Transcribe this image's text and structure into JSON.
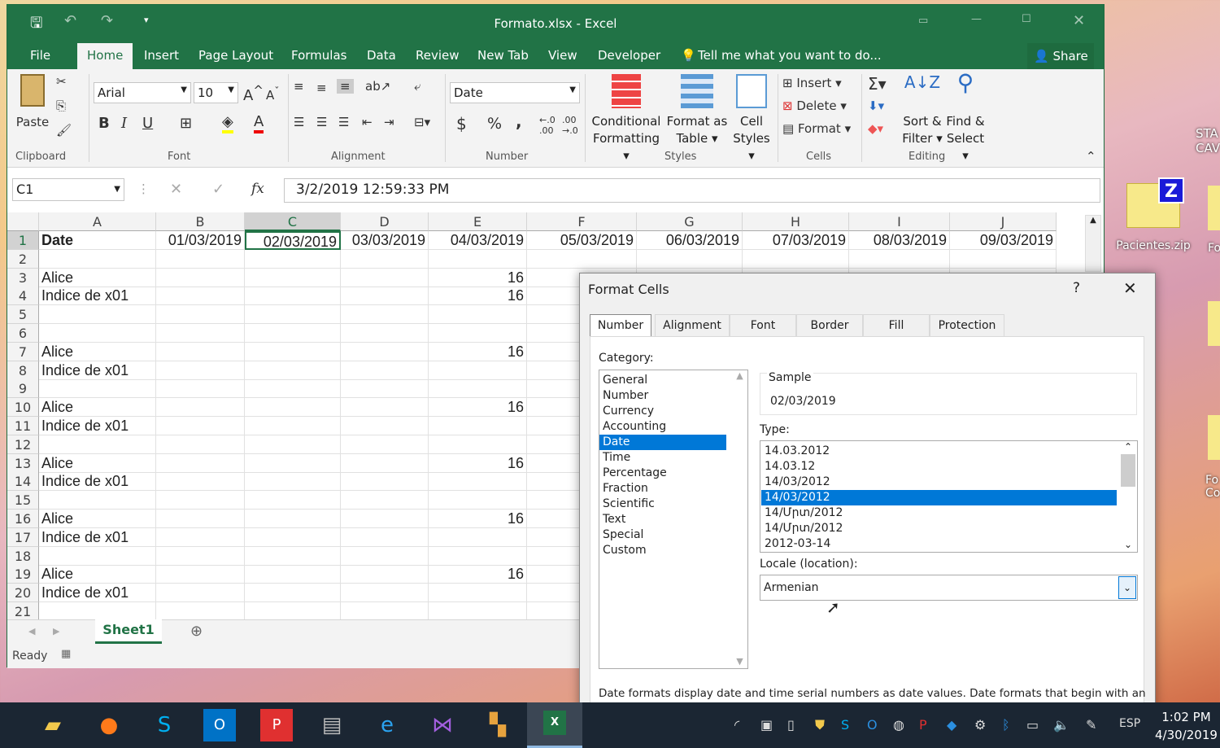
{
  "window": {
    "title": "Formato.xlsx - Excel"
  },
  "tabs": [
    "File",
    "Home",
    "Insert",
    "Page Layout",
    "Formulas",
    "Data",
    "Review",
    "New Tab",
    "View",
    "Developer"
  ],
  "tell_me": "Tell me what you want to do...",
  "share": "Share",
  "ribbon": {
    "clipboard": {
      "label": "Clipboard",
      "paste": "Paste"
    },
    "font": {
      "label": "Font",
      "name": "Arial",
      "size": "10",
      "bold": "B",
      "italic": "I",
      "underline": "U"
    },
    "alignment": {
      "label": "Alignment"
    },
    "number": {
      "label": "Number",
      "format": "Date",
      "currency": "$",
      "percent": "%",
      "comma": ","
    },
    "styles": {
      "label": "Styles",
      "conditional": "Conditional Formatting",
      "format_table": "Format as Table",
      "cell_styles": "Cell Styles"
    },
    "cells": {
      "label": "Cells",
      "insert": "Insert",
      "delete": "Delete",
      "format": "Format"
    },
    "editing": {
      "label": "Editing",
      "sort": "Sort & Filter",
      "find": "Find & Select"
    }
  },
  "formula_bar": {
    "name_box": "C1",
    "fx": "fx",
    "value": "3/2/2019  12:59:33 PM"
  },
  "columns": [
    "A",
    "B",
    "C",
    "D",
    "E",
    "F",
    "G",
    "H",
    "I",
    "J"
  ],
  "rows": [
    [
      "Date",
      "01/03/2019",
      "02/03/2019",
      "03/03/2019",
      "04/03/2019",
      "05/03/2019",
      "06/03/2019",
      "07/03/2019",
      "08/03/2019",
      "09/03/2019"
    ],
    [
      "",
      "",
      "",
      "",
      "",
      "",
      "",
      "",
      "",
      ""
    ],
    [
      "Alice",
      "",
      "",
      "",
      "16"
    ],
    [
      "Indice de x01",
      "",
      "",
      "",
      "16"
    ],
    [
      "",
      "",
      "",
      "",
      ""
    ],
    [
      "",
      "",
      "",
      "",
      ""
    ],
    [
      "Alice",
      "",
      "",
      "",
      "16"
    ],
    [
      "Indice de x01",
      "",
      "",
      "",
      ""
    ],
    [
      "",
      "",
      "",
      "",
      ""
    ],
    [
      "Alice",
      "",
      "",
      "",
      "16"
    ],
    [
      "Indice de x01",
      "",
      "",
      "",
      ""
    ],
    [
      "",
      "",
      "",
      "",
      ""
    ],
    [
      "Alice",
      "",
      "",
      "",
      "16"
    ],
    [
      "Indice de x01",
      "",
      "",
      "",
      ""
    ],
    [
      "",
      "",
      "",
      "",
      ""
    ],
    [
      "Alice",
      "",
      "",
      "",
      "16"
    ],
    [
      "Indice de x01",
      "",
      "",
      "",
      ""
    ],
    [
      "",
      "",
      "",
      "",
      ""
    ],
    [
      "Alice",
      "",
      "",
      "",
      "16"
    ],
    [
      "Indice de x01",
      "",
      "",
      "",
      ""
    ],
    [
      "",
      "",
      "",
      "",
      ""
    ]
  ],
  "sheet_tab": "Sheet1",
  "status": "Ready",
  "dialog": {
    "title": "Format Cells",
    "help": "?",
    "tabs": [
      "Number",
      "Alignment",
      "Font",
      "Border",
      "Fill",
      "Protection"
    ],
    "category_label": "Category:",
    "categories": [
      "General",
      "Number",
      "Currency",
      "Accounting",
      "Date",
      "Time",
      "Percentage",
      "Fraction",
      "Scientific",
      "Text",
      "Special",
      "Custom"
    ],
    "selected_category": "Date",
    "sample_label": "Sample",
    "sample_value": "02/03/2019",
    "type_label": "Type:",
    "types": [
      "14.03.2012",
      "14.03.12",
      "14/03/2012",
      "14/03/2012",
      "14/Մրտ/2012",
      "14/Մրտ/2012",
      "2012-03-14"
    ],
    "selected_type_index": 3,
    "locale_label": "Locale (location):",
    "locale_value": "Armenian",
    "description": "Date formats display date and time serial numbers as date values.  Date formats that begin with an"
  },
  "desktop": {
    "icons": [
      "Pacientes.zip",
      "Fo",
      "STA CAV",
      "Fo Co"
    ]
  },
  "taskbar": {
    "lang": "ESP",
    "time": "1:02 PM",
    "date": "4/30/2019"
  },
  "colors": {
    "excel_green": "#217346",
    "selection_blue": "#0078d7"
  }
}
